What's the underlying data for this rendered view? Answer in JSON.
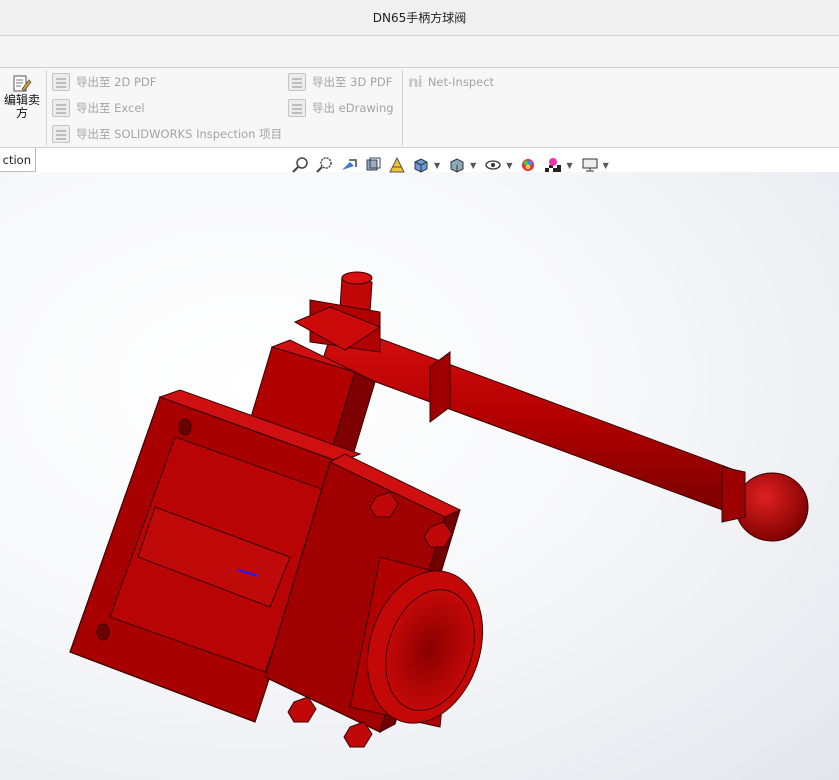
{
  "window": {
    "title": "DN65手柄方球阀"
  },
  "ribbon": {
    "edit_button_label": "编辑卖方",
    "export_2d_pdf": "导出至 2D PDF",
    "export_excel": "导出至 Excel",
    "export_inspection": "导出至 SOLIDWORKS Inspection 项目",
    "export_3d_pdf": "导出至 3D PDF",
    "export_edrawing": "导出 eDrawing",
    "net_inspect": "Net-Inspect",
    "net_inspect_logo": "ni"
  },
  "tabs": {
    "active_tab_fragment": "ction"
  },
  "heads_up_toolbar": {
    "icons": [
      "zoom-to-fit-icon",
      "zoom-to-area-icon",
      "previous-view-icon",
      "section-view-icon",
      "dynamic-annotation-icon",
      "view-orientation-icon",
      "display-style-icon",
      "hide-show-items-icon",
      "edit-appearance-icon",
      "apply-scene-icon",
      "view-settings-icon"
    ]
  },
  "model": {
    "color": "#b30000",
    "highlight": "#d81010",
    "shadow": "#6a0000"
  }
}
